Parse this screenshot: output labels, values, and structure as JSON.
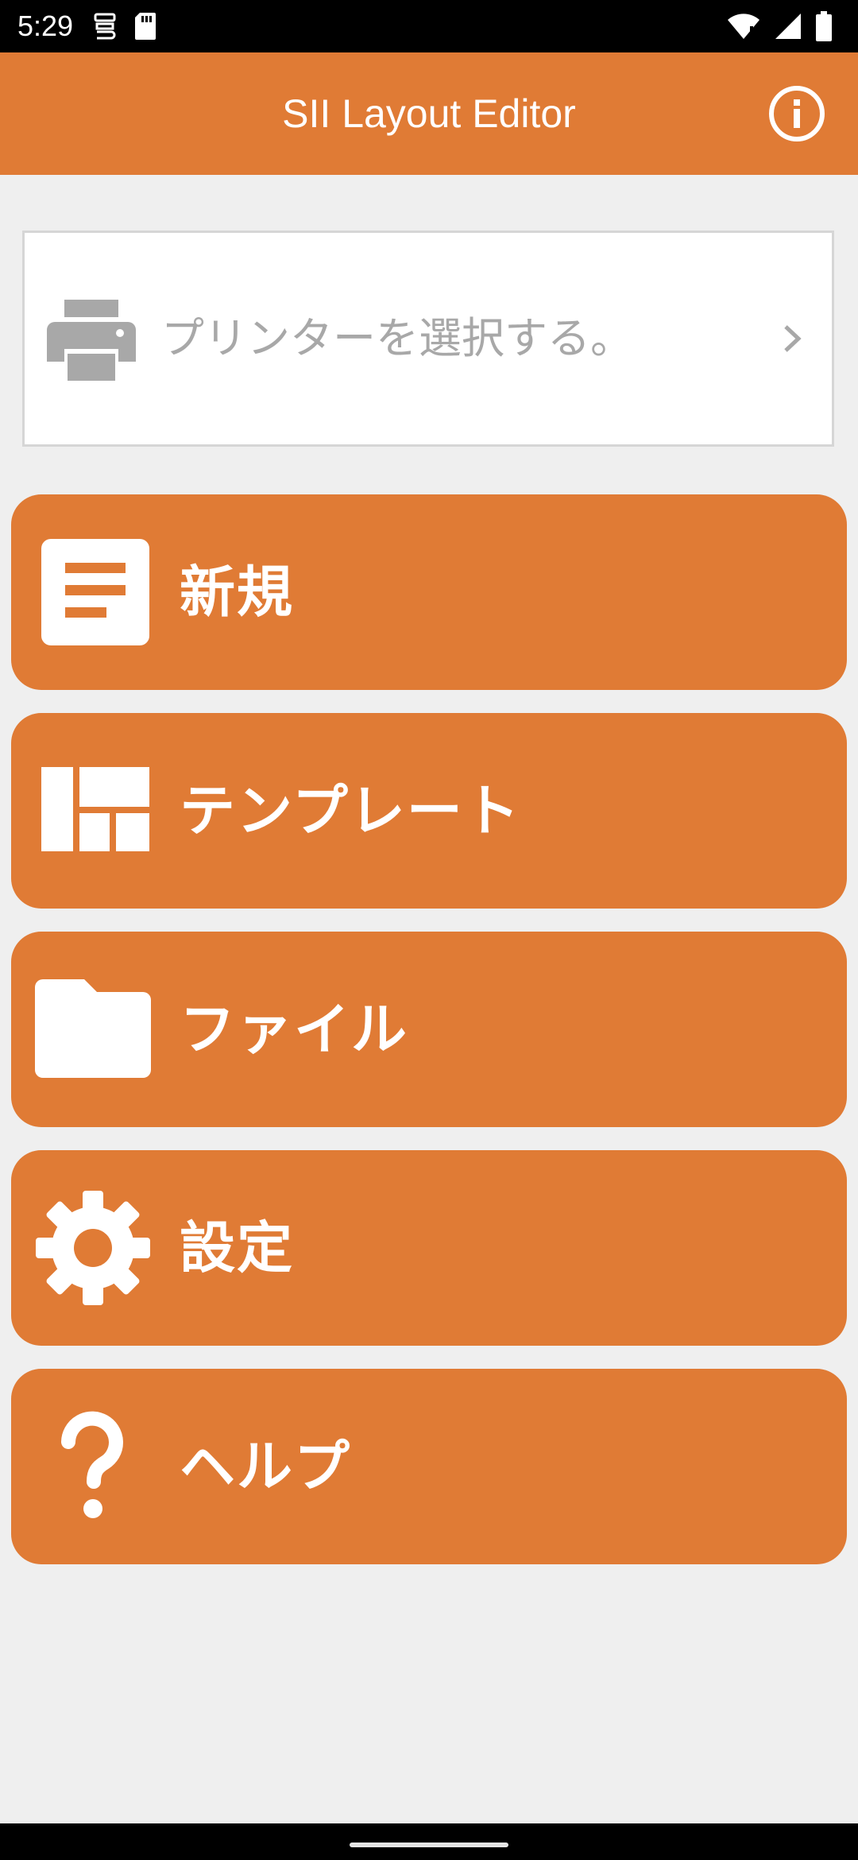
{
  "status_bar": {
    "time": "5:29"
  },
  "app_bar": {
    "title": "SII Layout Editor",
    "info_icon": "info-icon"
  },
  "printer_select": {
    "label": "プリンターを選択する。",
    "icon": "printer-icon"
  },
  "menu": [
    {
      "id": "new",
      "label": "新規",
      "icon": "document-icon"
    },
    {
      "id": "template",
      "label": "テンプレート",
      "icon": "template-icon"
    },
    {
      "id": "file",
      "label": "ファイル",
      "icon": "folder-icon"
    },
    {
      "id": "settings",
      "label": "設定",
      "icon": "gear-icon"
    },
    {
      "id": "help",
      "label": "ヘルプ",
      "icon": "help-icon"
    }
  ],
  "colors": {
    "accent": "#e07b35",
    "background": "#efefef",
    "card": "#ffffff",
    "placeholder_text": "#a8a8a8"
  }
}
